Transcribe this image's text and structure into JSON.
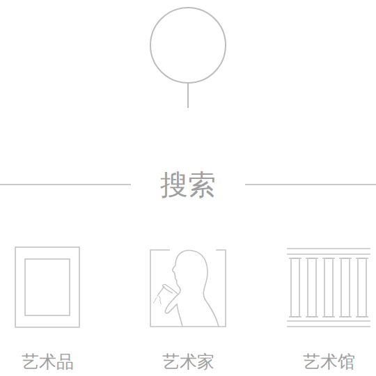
{
  "title": "搜索",
  "categories": [
    {
      "label": "艺术品",
      "kind": "artwork"
    },
    {
      "label": "艺术家",
      "kind": "artist"
    },
    {
      "label": "艺术馆",
      "kind": "museum"
    }
  ]
}
